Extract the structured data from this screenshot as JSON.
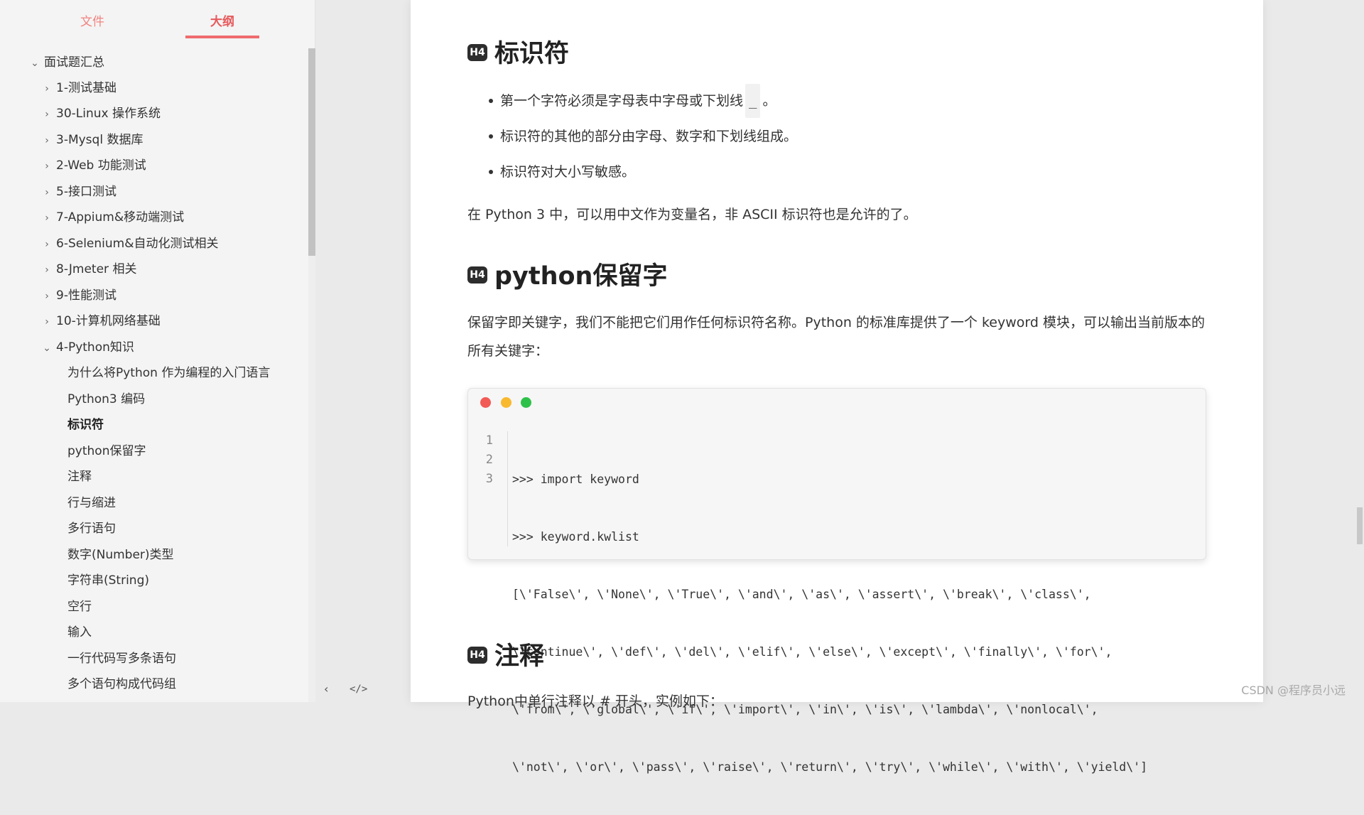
{
  "sidebar": {
    "tabs": [
      {
        "label": "文件",
        "active": false
      },
      {
        "label": "大纲",
        "active": true
      }
    ],
    "tree": [
      {
        "label": "面试题汇总",
        "level": 0,
        "arrow": "expanded"
      },
      {
        "label": "1-测试基础",
        "level": 1,
        "arrow": "collapsed"
      },
      {
        "label": "30-Linux 操作系统",
        "level": 1,
        "arrow": "collapsed"
      },
      {
        "label": "3-Mysql 数据库",
        "level": 1,
        "arrow": "collapsed"
      },
      {
        "label": "2-Web 功能测试",
        "level": 1,
        "arrow": "collapsed"
      },
      {
        "label": "5-接口测试",
        "level": 1,
        "arrow": "collapsed"
      },
      {
        "label": "7-Appium&移动端测试",
        "level": 1,
        "arrow": "collapsed"
      },
      {
        "label": "6-Selenium&自动化测试相关",
        "level": 1,
        "arrow": "collapsed"
      },
      {
        "label": "8-Jmeter 相关",
        "level": 1,
        "arrow": "collapsed"
      },
      {
        "label": "9-性能测试",
        "level": 1,
        "arrow": "collapsed"
      },
      {
        "label": "10-计算机网络基础",
        "level": 1,
        "arrow": "collapsed"
      },
      {
        "label": "4-Python知识",
        "level": 1,
        "arrow": "expanded"
      },
      {
        "label": "为什么将Python 作为编程的入门语言",
        "level": 2,
        "arrow": "none"
      },
      {
        "label": "Python3 编码",
        "level": 2,
        "arrow": "none"
      },
      {
        "label": "标识符",
        "level": 2,
        "arrow": "none",
        "active": true
      },
      {
        "label": "python保留字",
        "level": 2,
        "arrow": "none"
      },
      {
        "label": "注释",
        "level": 2,
        "arrow": "none"
      },
      {
        "label": "行与缩进",
        "level": 2,
        "arrow": "none"
      },
      {
        "label": "多行语句",
        "level": 2,
        "arrow": "none"
      },
      {
        "label": "数字(Number)类型",
        "level": 2,
        "arrow": "none"
      },
      {
        "label": "字符串(String)",
        "level": 2,
        "arrow": "none"
      },
      {
        "label": "空行",
        "level": 2,
        "arrow": "none"
      },
      {
        "label": "输入",
        "level": 2,
        "arrow": "none"
      },
      {
        "label": "一行代码写多条语句",
        "level": 2,
        "arrow": "none"
      },
      {
        "label": "多个语句构成代码组",
        "level": 2,
        "arrow": "none"
      }
    ],
    "footer": {
      "collapse_icon": "‹",
      "source_icon": "</>"
    }
  },
  "document": {
    "heading_badge": "H4",
    "section1": {
      "title": "标识符",
      "bullet1_before": "第一个字符必须是字母表中字母或下划线",
      "bullet1_code": "_",
      "bullet1_after": "。",
      "bullet2": "标识符的其他的部分由字母、数字和下划线组成。",
      "bullet3": "标识符对大小写敏感。",
      "paragraph": "在 Python 3 中，可以用中文作为变量名，非 ASCII 标识符也是允许的了。"
    },
    "section2": {
      "title": "python保留字",
      "paragraph": "保留字即关键字，我们不能把它们用作任何标识符名称。Python 的标准库提供了一个 keyword 模块，可以输出当前版本的所有关键字：",
      "code": {
        "gutter": [
          "1",
          "2",
          "3"
        ],
        "lines": [
          ">>> import keyword",
          ">>> keyword.kwlist",
          "[\\'False\\', \\'None\\', \\'True\\', \\'and\\', \\'as\\', \\'assert\\', \\'break\\', \\'class\\',",
          "\\'continue\\', \\'def\\', \\'del\\', \\'elif\\', \\'else\\', \\'except\\', \\'finally\\', \\'for\\',",
          "\\'from\\', \\'global\\', \\'if\\', \\'import\\', \\'in\\', \\'is\\', \\'lambda\\', \\'nonlocal\\',",
          "\\'not\\', \\'or\\', \\'pass\\', \\'raise\\', \\'return\\', \\'try\\', \\'while\\', \\'with\\', \\'yield\\']"
        ]
      }
    },
    "section3": {
      "title": "注释",
      "partial_text": "Python中单行注释以 # 开头，实例如下："
    }
  },
  "watermark": "CSDN @程序员小远"
}
